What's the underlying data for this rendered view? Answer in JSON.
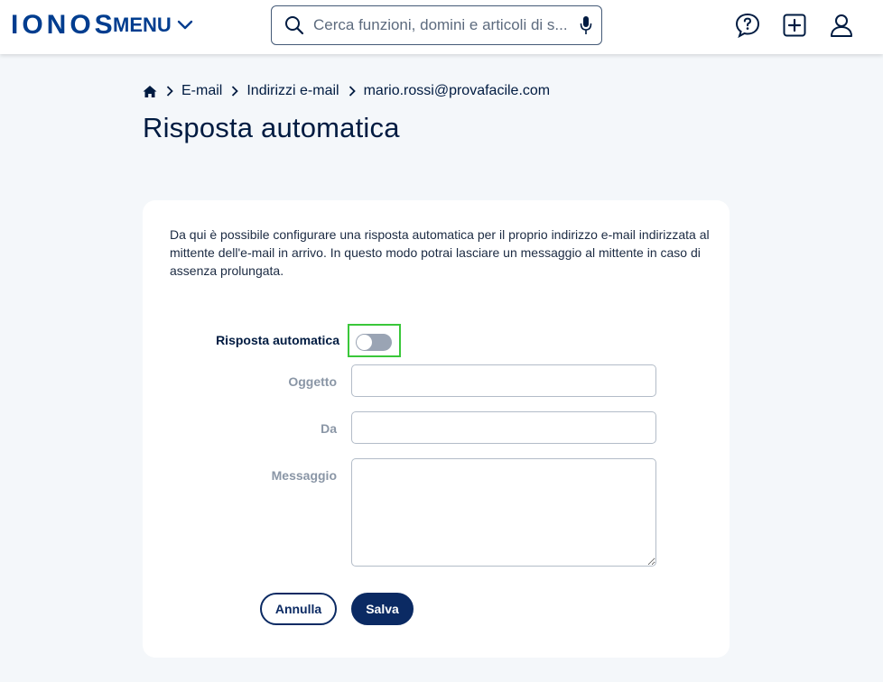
{
  "header": {
    "logo": "IONOS",
    "menu_label": "MENU",
    "search_placeholder": "Cerca funzioni, domini e articoli di s...",
    "icons": [
      "help-icon",
      "add-icon",
      "user-icon"
    ]
  },
  "breadcrumb": {
    "items": [
      "E-mail",
      "Indirizzi e-mail",
      "mario.rossi@provafacile.com"
    ]
  },
  "page": {
    "title": "Risposta automatica"
  },
  "form": {
    "intro": "Da qui è possibile configurare una risposta automatica per il proprio indirizzo e-mail indirizzata al mittente dell'e-mail in arrivo. In questo modo potrai lasciare un messaggio al mittente in caso di assenza prolungata.",
    "toggle_label": "Risposta automatica",
    "toggle_on": false,
    "subject_label": "Oggetto",
    "subject_value": "",
    "from_label": "Da",
    "from_value": "",
    "message_label": "Messaggio",
    "message_value": "",
    "cancel_label": "Annulla",
    "save_label": "Salva"
  },
  "colors": {
    "brand": "#003d8f",
    "primary_button": "#0b2a63",
    "highlight": "#3ac73a",
    "background": "#f4f7fa"
  }
}
